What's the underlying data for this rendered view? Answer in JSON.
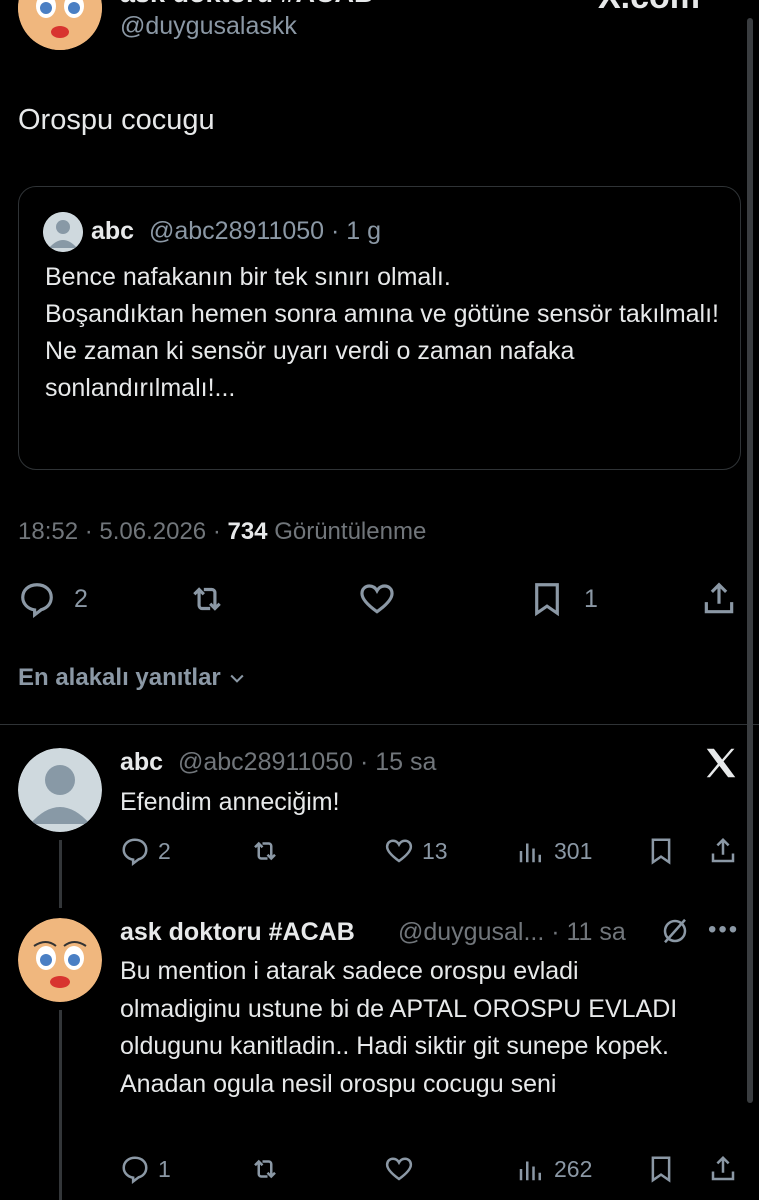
{
  "header": {
    "display_name": "ask doktoru #ACAB",
    "handle": "@duygusalaskk",
    "watermark": "X.com"
  },
  "post": {
    "text": "Orospu cocugu",
    "quote": {
      "name": "abc",
      "meta": "@abc28911050 · 1 g",
      "body": "Bence nafakanın bir tek sınırı olmalı.\nBoşandıktan hemen sonra amına ve götüne sensör takılmalı!\nNe zaman ki sensör uyarı verdi o zaman nafaka sonlandırılmalı!..."
    },
    "time": "18:52 · 5.06.2026 · ",
    "views": "734",
    "views_label": " Görüntülenme",
    "actions": {
      "replies": "2",
      "reposts": "",
      "likes": "",
      "bookmarks": "1"
    }
  },
  "sort_label": "En alakalı yanıtlar",
  "replies": [
    {
      "name": "abc",
      "meta": "@abc28911050 · 15 sa",
      "text": "Efendim anneciğim!",
      "replies": "2",
      "likes": "13",
      "views": "301"
    },
    {
      "name": "ask doktoru #ACAB",
      "meta": "@duygusal... · 11 sa",
      "text": "Bu mention i atarak sadece orospu evladi olmadiginu ustune bi de APTAL OROSPU EVLADI oldugunu kanitladin.. Hadi siktir git sunepe kopek. Anadan ogula nesil orospu cocugu seni",
      "replies": "1",
      "likes": "",
      "views": "262"
    }
  ],
  "icons": {
    "reply": "reply-icon",
    "repost": "repost-icon",
    "like": "heart-icon",
    "bookmark": "bookmark-icon",
    "share": "share-icon",
    "views": "views-icon",
    "x_logo": "x-logo-icon",
    "grok": "grok-icon",
    "more": "more-icon"
  },
  "colors": {
    "background": "#000000",
    "text": "#e7e9ea",
    "muted": "#71767b",
    "border": "#2f3336"
  }
}
